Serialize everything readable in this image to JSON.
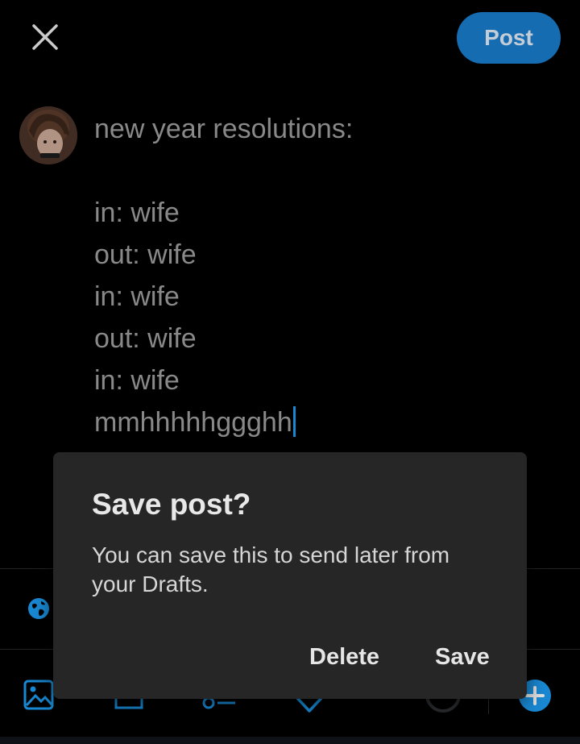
{
  "header": {
    "close_icon": "close-icon",
    "post_label": "Post",
    "accent_color": "#1a7bc9"
  },
  "composer": {
    "avatar_icon": "avatar",
    "lines": [
      "new year resolutions:",
      "",
      "in: wife",
      "out: wife",
      "in: wife",
      "out: wife",
      "in: wife",
      "mmhhhhhggghh"
    ]
  },
  "reply_settings": {
    "icon": "globe-icon"
  },
  "toolbar": {
    "icons": [
      "image-icon",
      "gif-icon",
      "poll-icon",
      "location-icon",
      "char-count-ring-icon",
      "add-post-icon"
    ]
  },
  "dialog": {
    "title": "Save post?",
    "body": "You can save this to send later from your Drafts.",
    "delete_label": "Delete",
    "save_label": "Save"
  }
}
